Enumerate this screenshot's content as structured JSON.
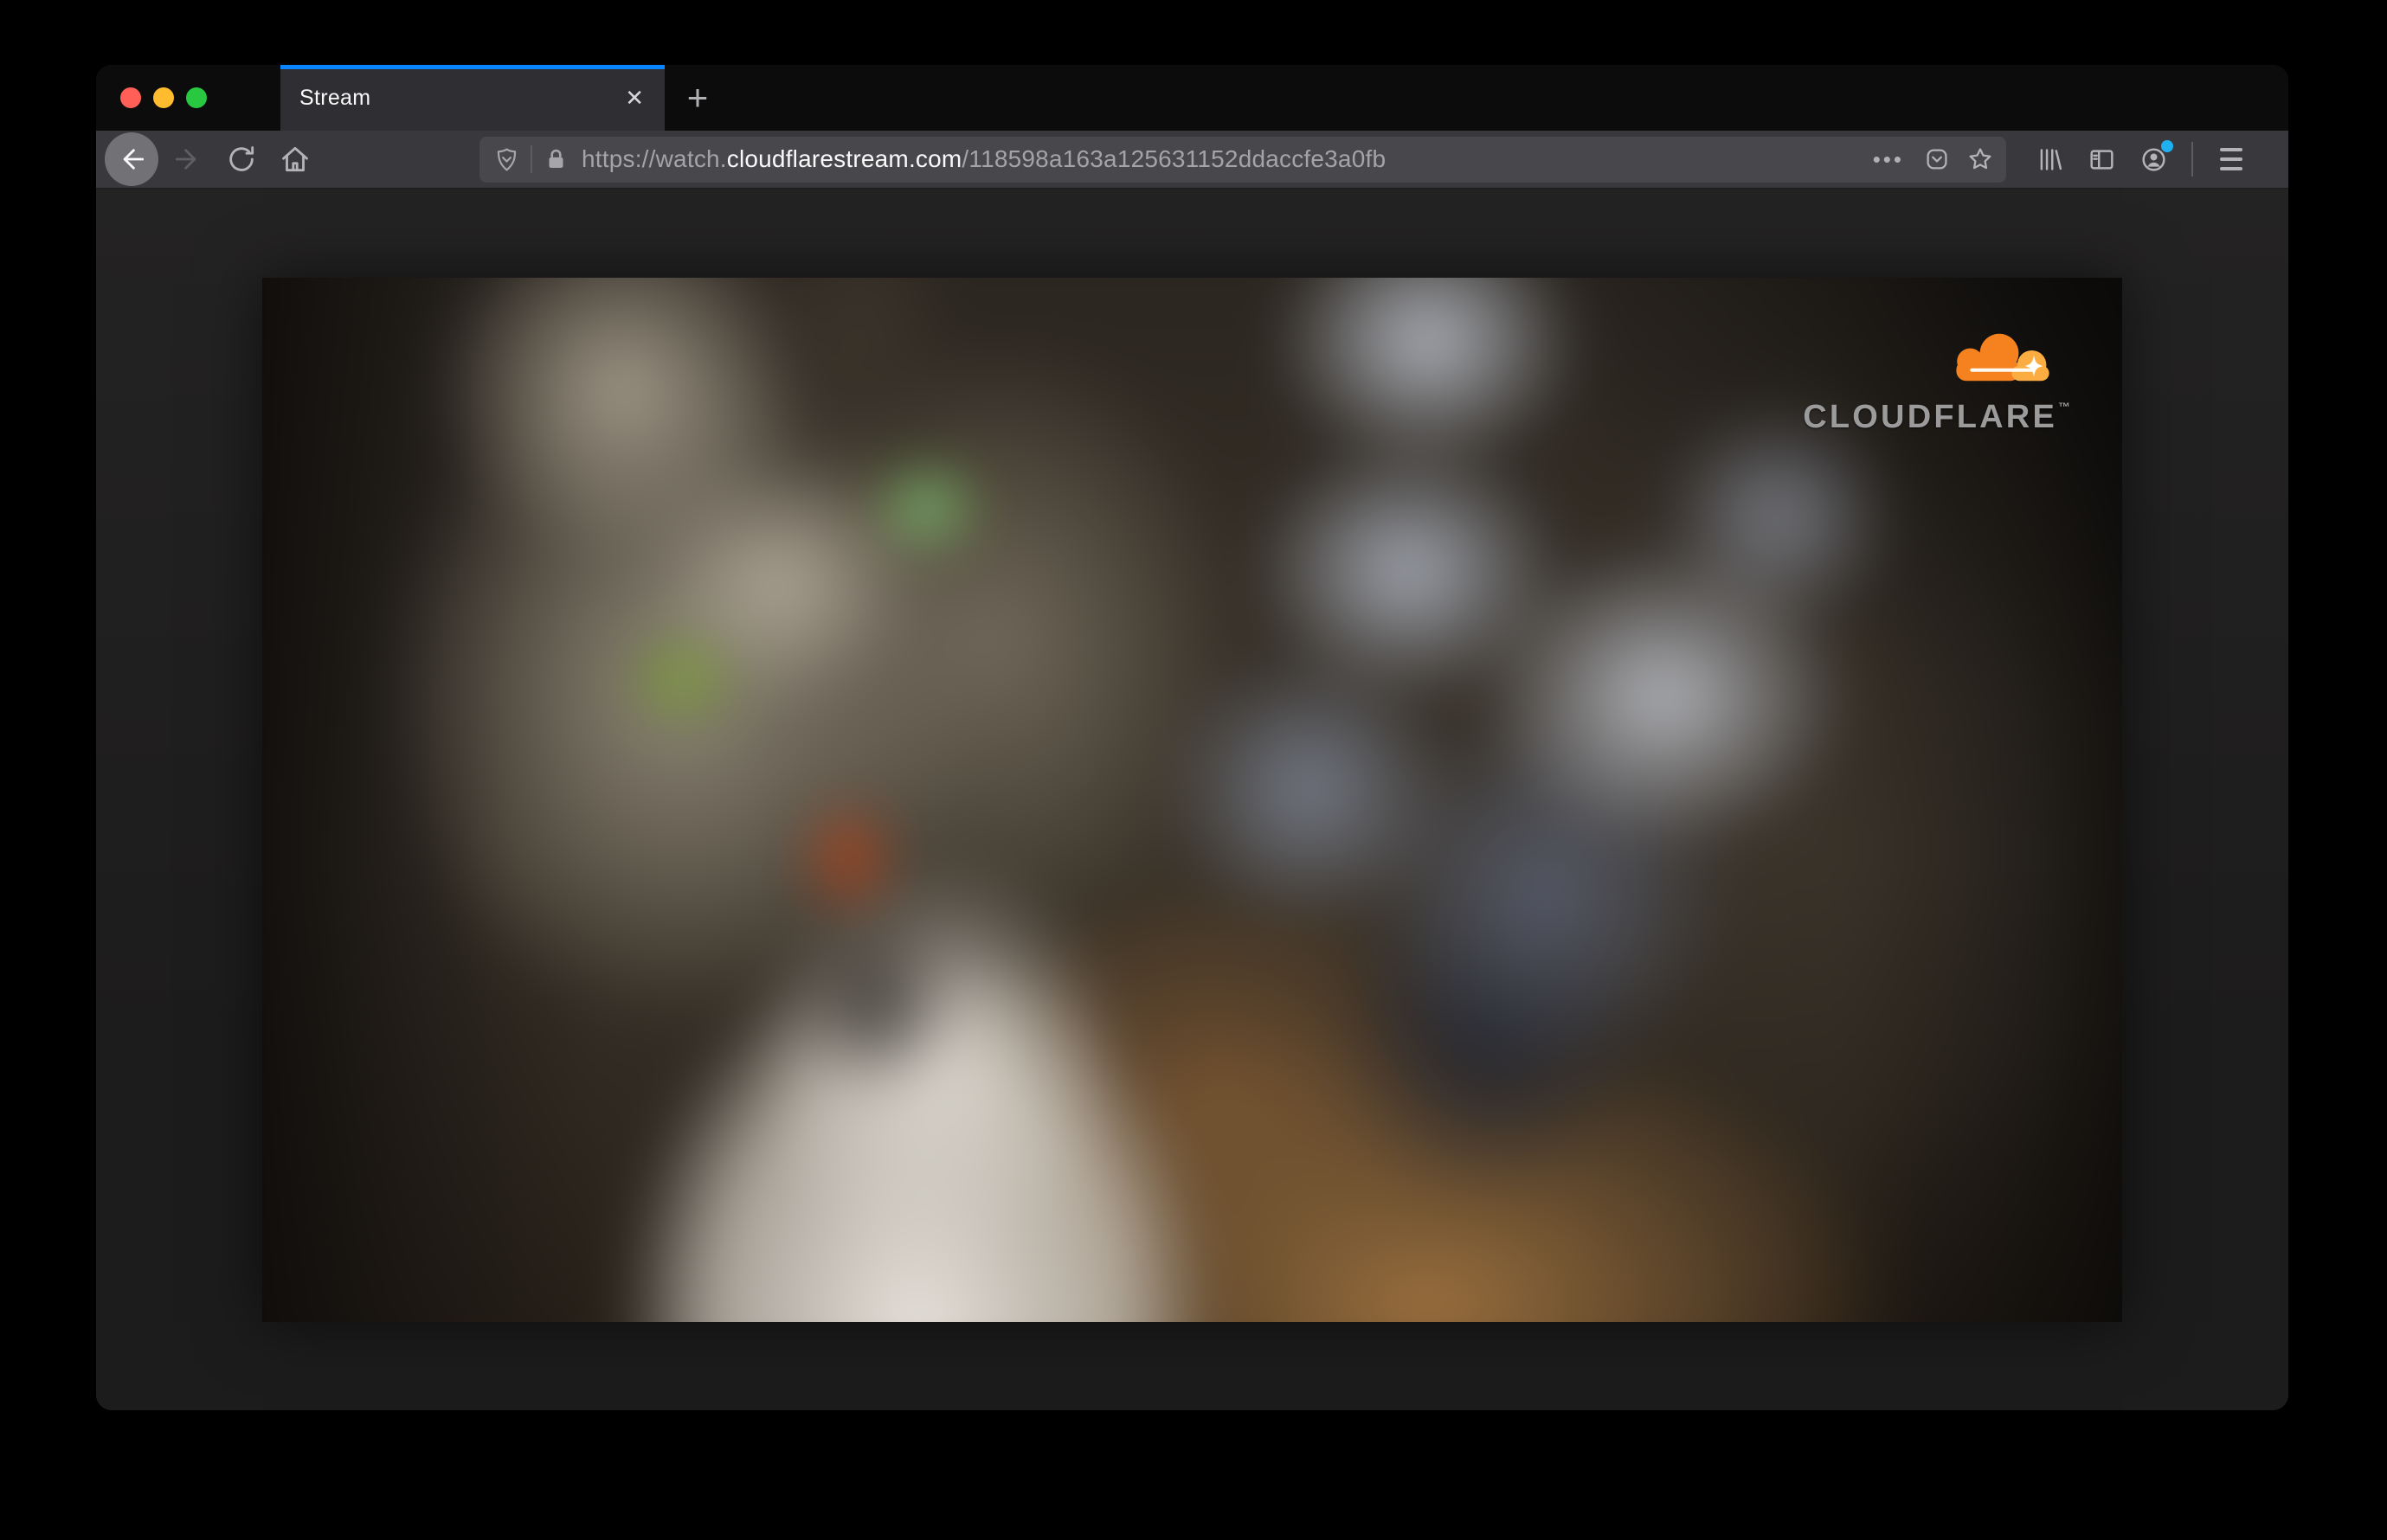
{
  "browser": {
    "tab": {
      "title": "Stream",
      "close_glyph": "✕"
    },
    "new_tab_glyph": "+",
    "urlbar": {
      "prefix": "https://watch.",
      "domain": "cloudflarestream.com",
      "path": "/118598a163a125631152ddaccfe3a0fb",
      "page_actions_glyph": "•••"
    }
  },
  "page": {
    "brand_wordmark": "CLOUDFLARE",
    "brand_tm": "™"
  },
  "icons": {
    "traffic_lights": [
      "close-window",
      "minimize-window",
      "zoom-window"
    ],
    "nav": [
      "back",
      "forward",
      "reload",
      "home"
    ],
    "urlbar": [
      "tracking-protection-shield",
      "lock",
      "page-actions-dots",
      "pocket",
      "bookmark-star"
    ],
    "toolbar_right": [
      "library",
      "sidebar",
      "account-with-notification",
      "menu-hamburger"
    ]
  },
  "colors": {
    "accent_blue": "#0a84ff",
    "badge_blue": "#1fb0f2",
    "traffic_red": "#ff5f57",
    "traffic_yellow": "#febc2e",
    "traffic_green": "#28c840",
    "cloud_orange": "#f6821f",
    "cloud_orange_light": "#fbad41",
    "wordmark_gray": "#9b9b9b"
  }
}
